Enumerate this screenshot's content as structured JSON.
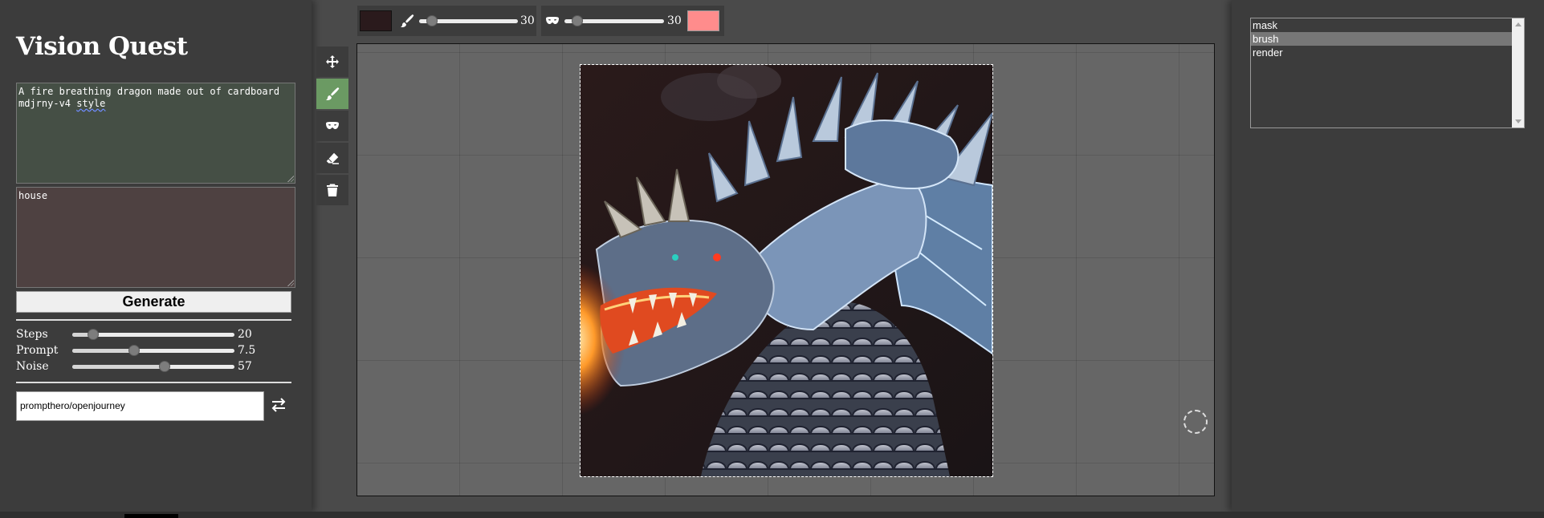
{
  "app": {
    "title": "Vision Quest"
  },
  "prompts": {
    "positive_line1": "A fire breathing dragon made out of cardboard",
    "positive_line2a": "mdjrny-v4 ",
    "positive_line2b": "style",
    "negative": "house"
  },
  "generate": {
    "label": "Generate"
  },
  "sliders": [
    {
      "label": "Steps",
      "value": "20",
      "fraction": 0.13
    },
    {
      "label": "Prompt",
      "value": "7.5",
      "fraction": 0.38
    },
    {
      "label": "Noise",
      "value": "57",
      "fraction": 0.57
    }
  ],
  "model": {
    "value": "prompthero/openjourney"
  },
  "tools": [
    {
      "name": "move-icon",
      "active": false
    },
    {
      "name": "brush-icon",
      "active": true
    },
    {
      "name": "mask-icon",
      "active": false
    },
    {
      "name": "eraser-icon",
      "active": false
    },
    {
      "name": "trash-icon",
      "active": false
    }
  ],
  "toolbar": {
    "brush": {
      "color": "#2a1a1c",
      "size": "30",
      "fraction": 0.13,
      "icon": "brush-icon"
    },
    "mask": {
      "color": "#ff8c8c",
      "size": "30",
      "fraction": 0.13,
      "icon": "mask-icon"
    }
  },
  "layers": {
    "items": [
      "mask",
      "brush",
      "render"
    ],
    "selected": "brush"
  },
  "colors": {
    "active_tool": "#6b9a63",
    "panel_bg": "#3c3c3c",
    "page_bg": "#4a4a4a"
  }
}
